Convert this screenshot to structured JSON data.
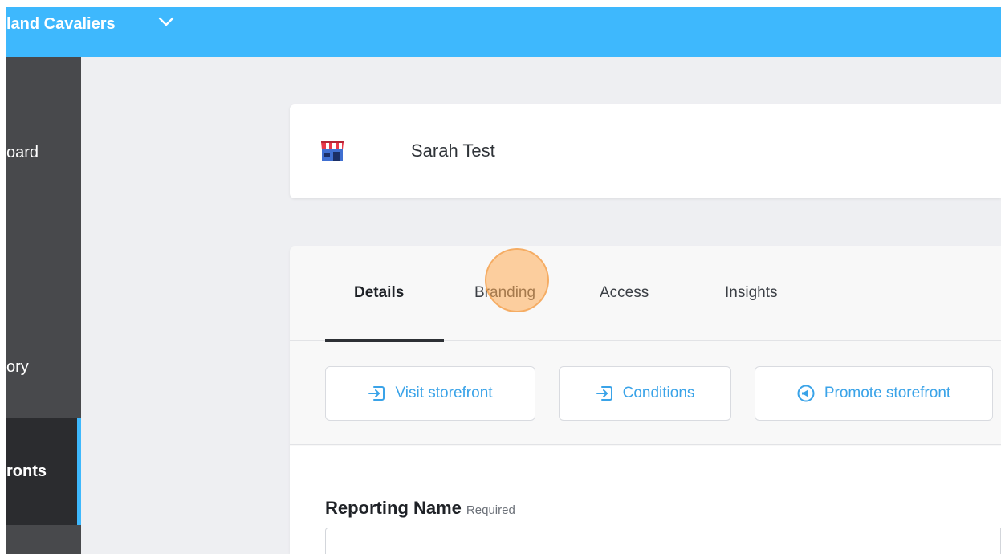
{
  "header": {
    "org_name": "land Cavaliers",
    "background_color": "#3eb8fd"
  },
  "sidebar": {
    "items": [
      {
        "label": "oard",
        "active": false
      },
      {
        "label": "ory",
        "active": false
      },
      {
        "label": "ronts",
        "active": true
      }
    ],
    "active_color": "#3eb8fd"
  },
  "storefront": {
    "name": "Sarah Test",
    "icon": "storefront-icon"
  },
  "tabs": [
    {
      "label": "Details",
      "active": true
    },
    {
      "label": "Branding",
      "active": false
    },
    {
      "label": "Access",
      "active": false
    },
    {
      "label": "Insights",
      "active": false
    }
  ],
  "actions": {
    "visit_storefront": {
      "label": "Visit storefront",
      "icon": "enter-arrow-icon"
    },
    "conditions": {
      "label": "Conditions",
      "icon": "enter-arrow-icon"
    },
    "promote_storefront": {
      "label": "Promote storefront",
      "icon": "megaphone-icon"
    }
  },
  "form": {
    "reporting_name": {
      "label": "Reporting Name",
      "required_text": "Required",
      "value": ""
    }
  },
  "colors": {
    "link_blue": "#3aa3e8",
    "sidebar_bg": "#48494c",
    "click_indicator": "#ffac54"
  }
}
